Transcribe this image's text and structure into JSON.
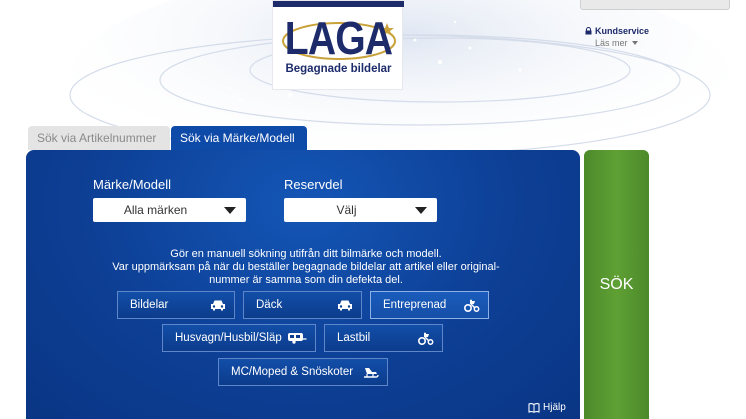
{
  "logo": {
    "brand": "LAGA",
    "tagline": "Begagnade bildelar"
  },
  "header": {
    "kundservice": "Kundservice",
    "las_mer": "Läs mer"
  },
  "tabs": [
    {
      "label": "Sök via Artikelnummer",
      "active": false
    },
    {
      "label": "Sök via Märke/Modell",
      "active": true
    }
  ],
  "form": {
    "make_label": "Märke/Modell",
    "make_value": "Alla märken",
    "part_label": "Reservdel",
    "part_value": "Välj"
  },
  "info": {
    "line1": "Gör en manuell sökning utifrån ditt bilmärke och modell.",
    "line2": "Var uppmärksam på när du beställer begagnade bildelar att artikel eller original-",
    "line3": "nummer är samma som din defekta del."
  },
  "categories": [
    {
      "label": "Bildelar",
      "icon": "car-icon"
    },
    {
      "label": "Däck",
      "icon": "car-icon"
    },
    {
      "label": "Entreprenad",
      "icon": "tractor-icon",
      "selected": true
    },
    {
      "label": "Husvagn/Husbil/Släp",
      "icon": "caravan-icon"
    },
    {
      "label": "Lastbil",
      "icon": "tractor-icon"
    },
    {
      "label": "MC/Moped & Snöskoter",
      "icon": "snowmobile-icon"
    }
  ],
  "help": "Hjälp",
  "search_button": "SÖK",
  "colors": {
    "panel_blue": "#0d3f95",
    "tab_active": "#0e4aa8",
    "search_green": "#5fa034",
    "brand_navy": "#1d2b6b"
  }
}
